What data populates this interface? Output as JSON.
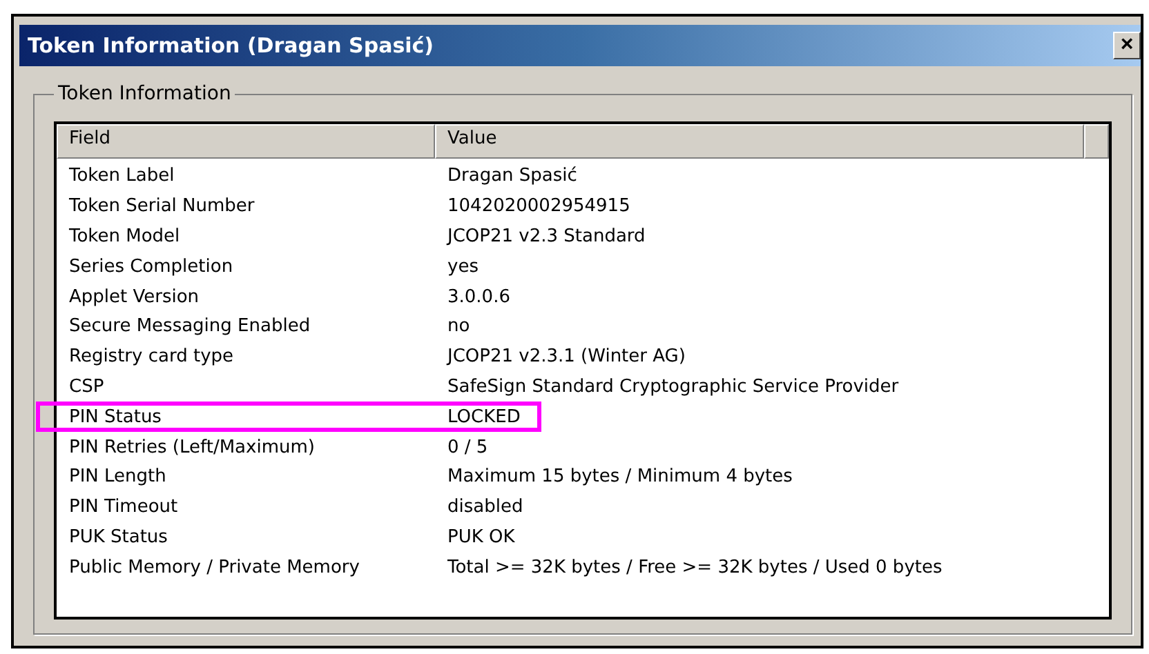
{
  "window": {
    "title": "Token Information (Dragan Spasić)",
    "close": "×"
  },
  "group": {
    "label": "Token Information"
  },
  "table": {
    "columns": [
      "Field",
      "Value"
    ],
    "rows": [
      {
        "field": "Token Label",
        "value": "Dragan Spasić",
        "highlighted": false
      },
      {
        "field": "Token Serial Number",
        "value": "1042020002954915",
        "highlighted": false
      },
      {
        "field": "Token Model",
        "value": "JCOP21 v2.3 Standard",
        "highlighted": false
      },
      {
        "field": "Series Completion",
        "value": "yes",
        "highlighted": false
      },
      {
        "field": "Applet Version",
        "value": "3.0.0.6",
        "highlighted": false
      },
      {
        "field": "Secure Messaging Enabled",
        "value": "no",
        "highlighted": false
      },
      {
        "field": "Registry card type",
        "value": "JCOP21 v2.3.1 (Winter AG)",
        "highlighted": false
      },
      {
        "field": "CSP",
        "value": "SafeSign Standard Cryptographic Service Provider",
        "highlighted": false
      },
      {
        "field": "PIN Status",
        "value": "LOCKED",
        "highlighted": true
      },
      {
        "field": "PIN Retries (Left/Maximum)",
        "value": "0 / 5",
        "highlighted": false
      },
      {
        "field": "PIN Length",
        "value": "Maximum 15 bytes / Minimum 4 bytes",
        "highlighted": false
      },
      {
        "field": "PIN Timeout",
        "value": "disabled",
        "highlighted": false
      },
      {
        "field": "PUK Status",
        "value": "PUK OK",
        "highlighted": false
      },
      {
        "field": "Public Memory / Private Memory",
        "value": "Total >= 32K bytes / Free >= 32K bytes / Used 0 bytes",
        "highlighted": false
      }
    ]
  }
}
